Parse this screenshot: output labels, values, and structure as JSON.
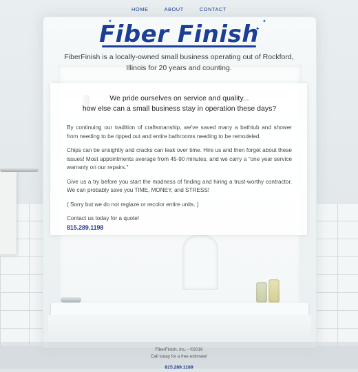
{
  "nav": {
    "items": [
      {
        "label": "HOME"
      },
      {
        "label": "ABOUT"
      },
      {
        "label": "CONTACT"
      }
    ]
  },
  "logo": {
    "text": "Fiber Finish"
  },
  "tagline": "FiberFinish is a locally-owned small business operating out of Rockford, Illinois for 20 years and counting.",
  "card": {
    "heading_line1": "We pride ourselves on service and quality...",
    "heading_line2": "how else can a small business stay in operation these days?",
    "paragraphs": [
      "By continuing our tradition of craftsmanship, we've saved many a bathtub and shower from needing to be ripped out and entire bathrooms needing to be remodeled.",
      "Chips can be unsightly and cracks can leak over time. Hire us and then forget about these issues! Most appointments average from 45-90 minutes, and we carry a \"one year service warranty on our repairs.\"",
      "Give us a try before you start the madness of finding and hiring a trust-worthy contractor. We can probably save you TIME, MONEY, and STRESS!",
      "( Sorry but we do not reglaze or recolor entire units. )"
    ],
    "contact_text": "Contact us today for a quote!",
    "phone": "815.289.1198"
  },
  "footer": {
    "copyright": "FiberFinish, Inc. - ©2016",
    "cta": "Call today for a free estimate!",
    "phone": "815.289.1189"
  },
  "colors": {
    "brand_blue": "#1b3f94",
    "text": "#444444"
  }
}
